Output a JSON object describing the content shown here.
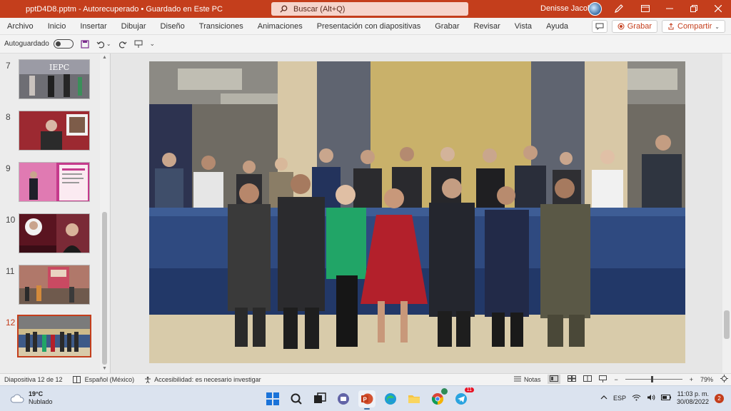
{
  "titlebar": {
    "doc_title": "pptD4D8.pptm  -  Autorecuperado • Guardado en Este PC",
    "search_placeholder": "Buscar (Alt+Q)",
    "user_name": "Denisse Jacobo"
  },
  "ribbon": {
    "tabs": [
      "Archivo",
      "Inicio",
      "Insertar",
      "Dibujar",
      "Diseño",
      "Transiciones",
      "Animaciones",
      "Presentación con diapositivas",
      "Grabar",
      "Revisar",
      "Vista",
      "Ayuda"
    ],
    "record_label": "Grabar",
    "share_label": "Compartir"
  },
  "qat": {
    "autosave_label": "Autoguardado"
  },
  "thumbnails": {
    "numbers": [
      "7",
      "8",
      "9",
      "10",
      "11",
      "12"
    ],
    "active": "12"
  },
  "statusbar": {
    "slide_info": "Diapositiva 12 de 12",
    "language": "Español (México)",
    "accessibility": "Accesibilidad: es necesario investigar",
    "notes_label": "Notas",
    "zoom": "79%"
  },
  "taskbar": {
    "weather_temp": "19°C",
    "weather_desc": "Nublado",
    "language": "ESP",
    "time": "11:03 p. m.",
    "date": "30/08/2022",
    "notification_count": "2",
    "chrome_badge": "11"
  },
  "colors": {
    "accent": "#c43e1c",
    "search_bg": "#f6d4cb",
    "taskbar_bg": "#dbe3ef"
  }
}
